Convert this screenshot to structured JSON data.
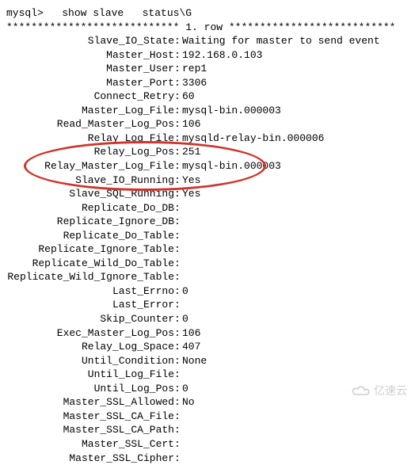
{
  "prompt": "mysql>   show slave   status\\G",
  "row_header": "**************************** 1. row ***************************",
  "fields": [
    {
      "label": "Slave_IO_State",
      "value": "Waiting for master to send event"
    },
    {
      "label": "Master_Host",
      "value": "192.168.0.103"
    },
    {
      "label": "Master_User",
      "value": "rep1"
    },
    {
      "label": "Master_Port",
      "value": "3306"
    },
    {
      "label": "Connect_Retry",
      "value": "60"
    },
    {
      "label": "Master_Log_File",
      "value": "mysql-bin.000003"
    },
    {
      "label": "Read_Master_Log_Pos",
      "value": "106"
    },
    {
      "label": "Relay_Log_File",
      "value": "mysqld-relay-bin.000006"
    },
    {
      "label": "Relay_Log_Pos",
      "value": "251"
    },
    {
      "label": "Relay_Master_Log_File",
      "value": "mysql-bin.000003"
    },
    {
      "label": "Slave_IO_Running",
      "value": "Yes"
    },
    {
      "label": "Slave_SQL_Running",
      "value": "Yes"
    },
    {
      "label": "Replicate_Do_DB",
      "value": ""
    },
    {
      "label": "Replicate_Ignore_DB",
      "value": ""
    },
    {
      "label": "Replicate_Do_Table",
      "value": ""
    },
    {
      "label": "Replicate_Ignore_Table",
      "value": ""
    },
    {
      "label": "Replicate_Wild_Do_Table",
      "value": ""
    },
    {
      "label": "Replicate_Wild_Ignore_Table",
      "value": ""
    },
    {
      "label": "Last_Errno",
      "value": "0"
    },
    {
      "label": "Last_Error",
      "value": ""
    },
    {
      "label": "Skip_Counter",
      "value": "0"
    },
    {
      "label": "Exec_Master_Log_Pos",
      "value": "106"
    },
    {
      "label": "Relay_Log_Space",
      "value": "407"
    },
    {
      "label": "Until_Condition",
      "value": "None"
    },
    {
      "label": "Until_Log_File",
      "value": ""
    },
    {
      "label": "Until_Log_Pos",
      "value": "0"
    },
    {
      "label": "Master_SSL_Allowed",
      "value": "No"
    },
    {
      "label": "Master_SSL_CA_File",
      "value": ""
    },
    {
      "label": "Master_SSL_CA_Path",
      "value": ""
    },
    {
      "label": "Master_SSL_Cert",
      "value": ""
    },
    {
      "label": "Master_SSL_Cipher",
      "value": ""
    }
  ],
  "watermark": "亿速云"
}
